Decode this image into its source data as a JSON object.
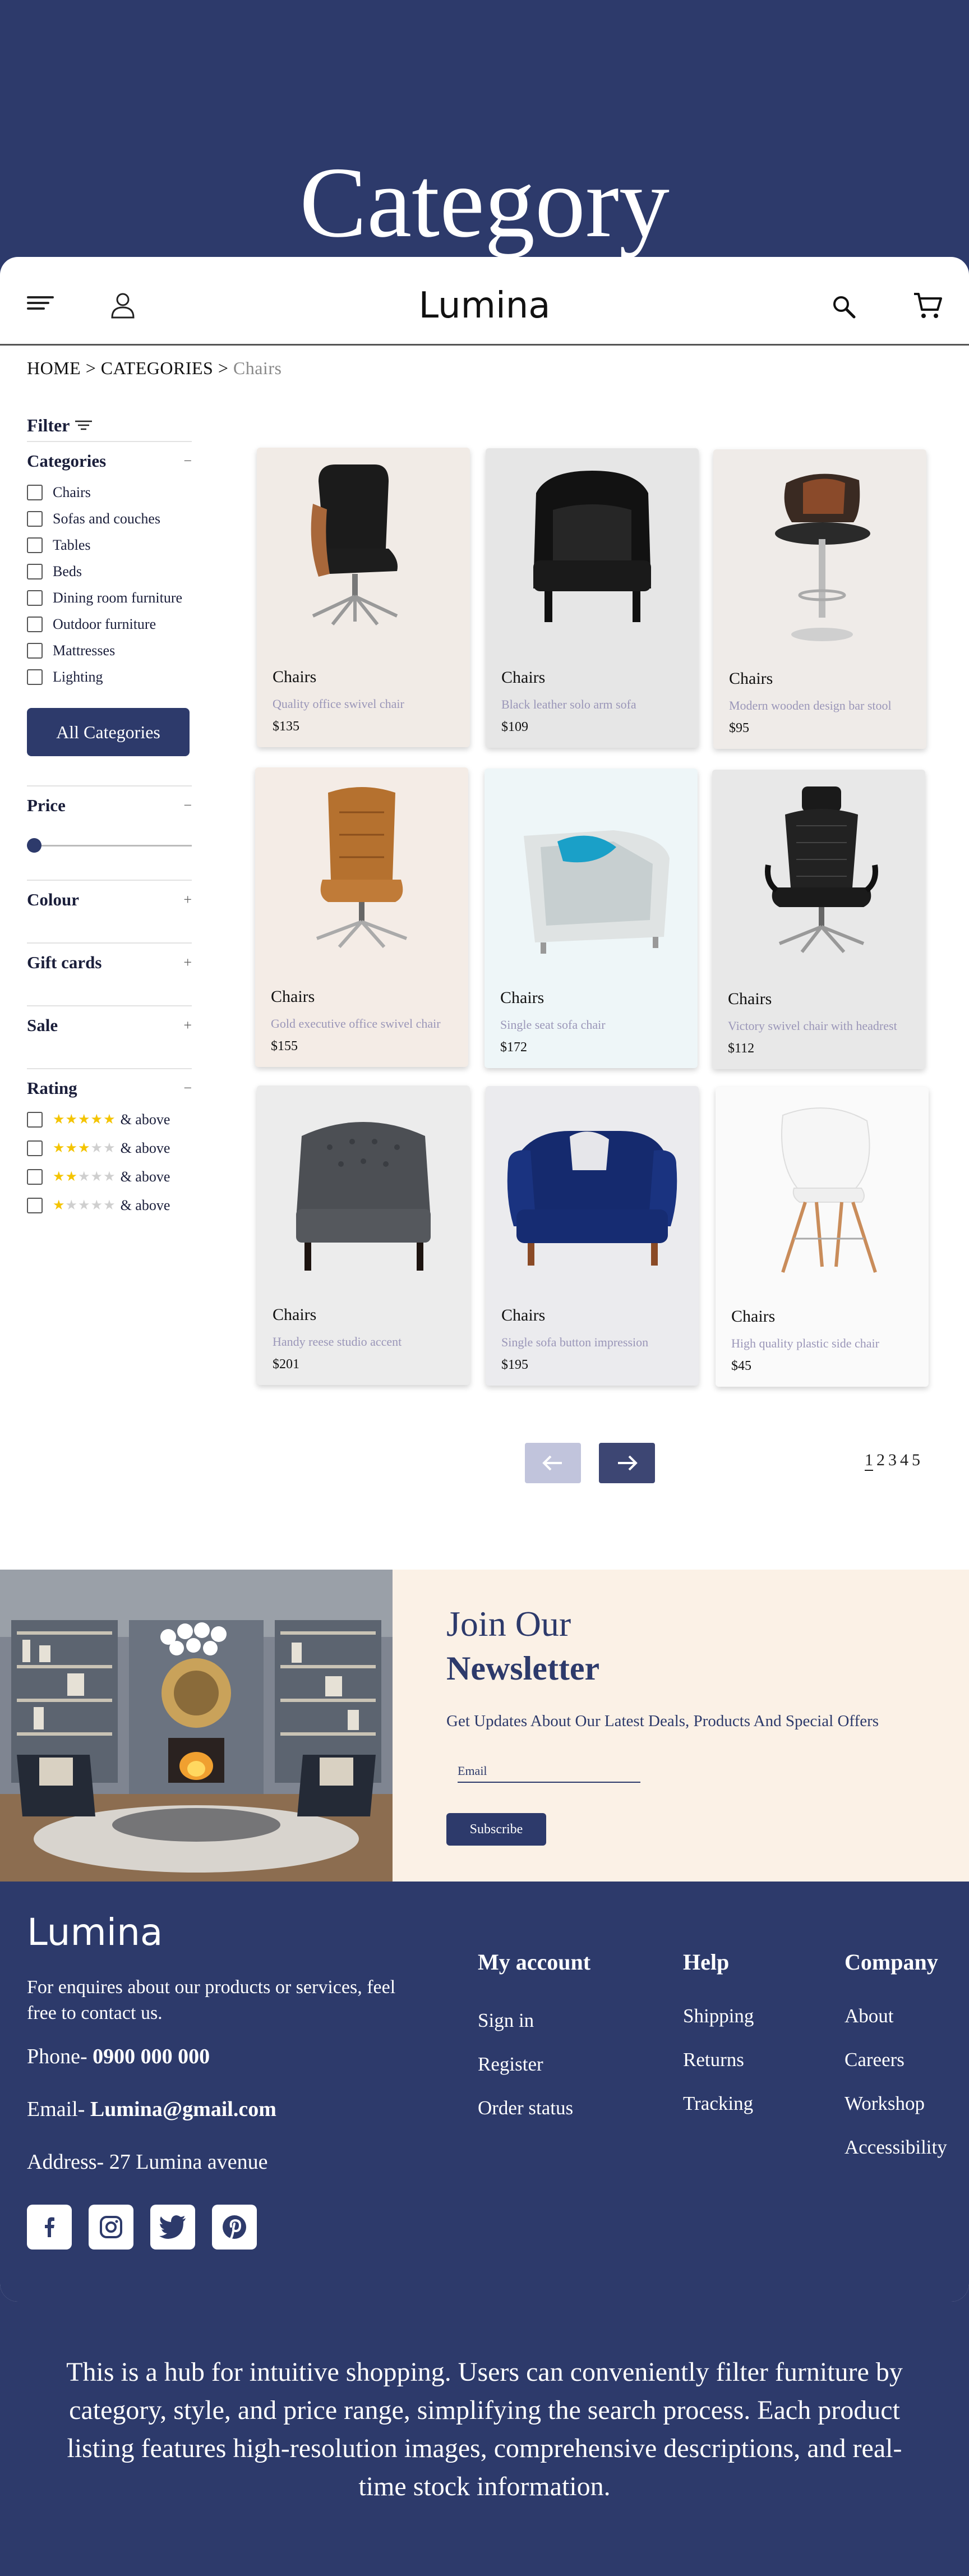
{
  "hero": {
    "title": "Category"
  },
  "header": {
    "brand": "Lumina"
  },
  "breadcrumb": {
    "home": "HOME >",
    "categories": "CATEGORIES >",
    "current": "Chairs"
  },
  "filter": {
    "title": "Filter",
    "categories": {
      "title": "Categories",
      "sign": "−",
      "items": [
        "Chairs",
        "Sofas and couches",
        "Tables",
        "Beds",
        "Dining room furniture",
        "Outdoor furniture",
        "Mattresses",
        "Lighting"
      ],
      "button": "All Categories"
    },
    "price": {
      "title": "Price",
      "sign": "−",
      "slider_value": 0
    },
    "colour": {
      "title": "Colour",
      "sign": "+"
    },
    "gift_cards": {
      "title": "Gift cards",
      "sign": "+"
    },
    "sale": {
      "title": "Sale",
      "sign": "+"
    },
    "rating": {
      "title": "Rating",
      "sign": "−",
      "items": [
        {
          "stars": 5,
          "label": "& above"
        },
        {
          "stars": 3,
          "label": "& above"
        },
        {
          "stars": 2,
          "label": "& above"
        },
        {
          "stars": 1,
          "label": "& above"
        }
      ]
    }
  },
  "products": [
    {
      "name": "Chairs",
      "desc": "Quality office swivel chair",
      "price": "$135",
      "bg": "#f1ebe6"
    },
    {
      "name": "Chairs",
      "desc": "Black leather solo arm sofa",
      "price": "$109",
      "bg": "#e6e6e6"
    },
    {
      "name": "Chairs",
      "desc": "Modern wooden design bar stool",
      "price": "$95",
      "bg": "#efebe8"
    },
    {
      "name": "Chairs",
      "desc": "Gold executive office swivel chair",
      "price": "$155",
      "bg": "#f4ece6"
    },
    {
      "name": "Chairs",
      "desc": "Single seat sofa chair",
      "price": "$172",
      "bg": "#eef6f8"
    },
    {
      "name": "Chairs",
      "desc": "Victory swivel chair with headrest",
      "price": "$112",
      "bg": "#e8e8e8"
    },
    {
      "name": "Chairs",
      "desc": "Handy reese studio accent",
      "price": "$201",
      "bg": "#ececec"
    },
    {
      "name": "Chairs",
      "desc": "Single sofa button impression",
      "price": "$195",
      "bg": "#ebebee"
    },
    {
      "name": "Chairs",
      "desc": "High quality plastic side chair",
      "price": "$45",
      "bg": "#fafafa"
    }
  ],
  "pagination": {
    "pages": [
      "1",
      "2",
      "3",
      "4",
      "5"
    ],
    "active": "1",
    "prev_color": "#c1c4dc",
    "next_color": "#3d4673"
  },
  "newsletter": {
    "join": "Join Our",
    "title": "Newsletter",
    "subtitle": "Get Updates About Our Latest Deals, Products And Special Offers",
    "email_placeholder": "Email",
    "button": "Subscribe"
  },
  "footer": {
    "brand": "Lumina",
    "enquiry": "For enquires about our products or services, feel free to contact us.",
    "phone_label": "Phone-",
    "phone": "0900 000 000",
    "email_label": "Email-",
    "email": "Lumina@gmail.com",
    "address": "Address- 27 Lumina avenue",
    "my_account": {
      "title": "My account",
      "links": [
        "Sign in",
        "Register",
        "Order status"
      ]
    },
    "help": {
      "title": "Help",
      "links": [
        "Shipping",
        "Returns",
        "Tracking"
      ]
    },
    "company": {
      "title": "Company",
      "links": [
        "About",
        "Careers",
        "Workshop",
        "Accessibility"
      ]
    },
    "social": [
      "facebook-icon",
      "instagram-icon",
      "twitter-icon",
      "pinterest-icon"
    ]
  },
  "caption": "This is a hub for intuitive shopping. Users can conveniently filter furniture by category, style, and price range, simplifying the search process. Each product listing features high-resolution images, comprehensive descriptions, and real-time stock information.",
  "colors": {
    "brand": "#2d3a6b",
    "star": "#f4c400",
    "muted_text": "#9a96b8"
  }
}
